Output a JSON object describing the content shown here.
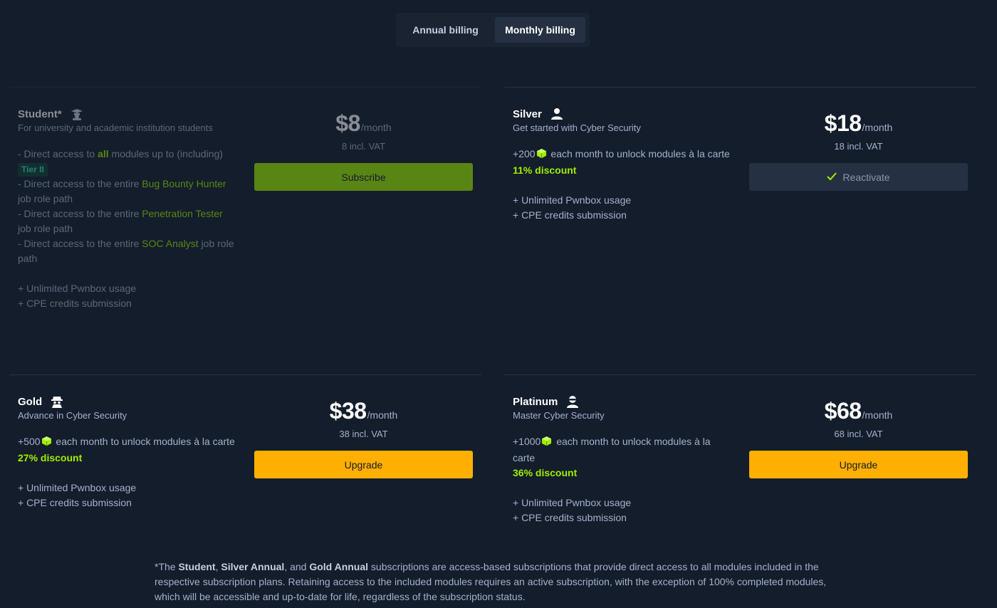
{
  "billing_toggle": {
    "annual_label": "Annual billing",
    "monthly_label": "Monthly billing",
    "selected": "monthly"
  },
  "plans": {
    "student": {
      "name": "Student*",
      "subtitle": "For university and academic institution students",
      "icon": "graduation-cap-icon",
      "f1_prefix": "- Direct access to ",
      "f1_highlight": "all",
      "f1_suffix": " modules up to (including)",
      "f1_badge": "Tier II",
      "f2_prefix": "- Direct access to the entire ",
      "f2_highlight": "Bug Bounty Hunter",
      "f2_suffix": " job role path",
      "f3_prefix": "- Direct access to the entire ",
      "f3_highlight": "Penetration Tester",
      "f3_suffix": " job role path",
      "f4_prefix": "- Direct access to the entire ",
      "f4_highlight": "SOC Analyst",
      "f4_suffix": " job role path",
      "extra1": "+ Unlimited Pwnbox usage",
      "extra2": "+ CPE credits submission",
      "price": "$8",
      "per": "/month",
      "vat": "8 incl. VAT",
      "action_label": "Subscribe"
    },
    "silver": {
      "name": "Silver",
      "subtitle": "Get started with Cyber Security",
      "icon": "user-icon",
      "cubes_prefix": "+200",
      "cubes_text": " each month to unlock modules à la carte",
      "discount": "11% discount",
      "extra1": "+ Unlimited Pwnbox usage",
      "extra2": "+ CPE credits submission",
      "price": "$18",
      "per": "/month",
      "vat": "18 incl. VAT",
      "action_label": "Reactivate"
    },
    "gold": {
      "name": "Gold",
      "subtitle": "Advance in Cyber Security",
      "icon": "spy-icon",
      "cubes_prefix": "+500",
      "cubes_text": " each month to unlock modules à la carte",
      "discount": "27% discount",
      "extra1": "+ Unlimited Pwnbox usage",
      "extra2": "+ CPE credits submission",
      "price": "$38",
      "per": "/month",
      "vat": "38 incl. VAT",
      "action_label": "Upgrade"
    },
    "platinum": {
      "name": "Platinum",
      "subtitle": "Master Cyber Security",
      "icon": "hacker-icon",
      "cubes_prefix": "+1000",
      "cubes_text": " each month to unlock modules à la carte",
      "discount": "36% discount",
      "extra1": "+ Unlimited Pwnbox usage",
      "extra2": "+ CPE credits submission",
      "price": "$68",
      "per": "/month",
      "vat": "68 incl. VAT",
      "action_label": "Upgrade"
    }
  },
  "footnote": {
    "p1": "*The ",
    "b1": "Student",
    "p2": ", ",
    "b2": "Silver Annual",
    "p3": ", and ",
    "b3": "Gold Annual",
    "p4": " subscriptions are access-based subscriptions that provide direct access to all modules included in the respective subscription plans. Retaining access to the included modules requires an active subscription, with the exception of 100% completed modules, which will be accessible and up-to-date for life, regardless of the subscription status."
  },
  "colors": {
    "background": "#141d2b",
    "accent_green": "#9fef00",
    "upgrade_yellow": "#ffaf00",
    "tier_teal": "#2ee7b6"
  }
}
